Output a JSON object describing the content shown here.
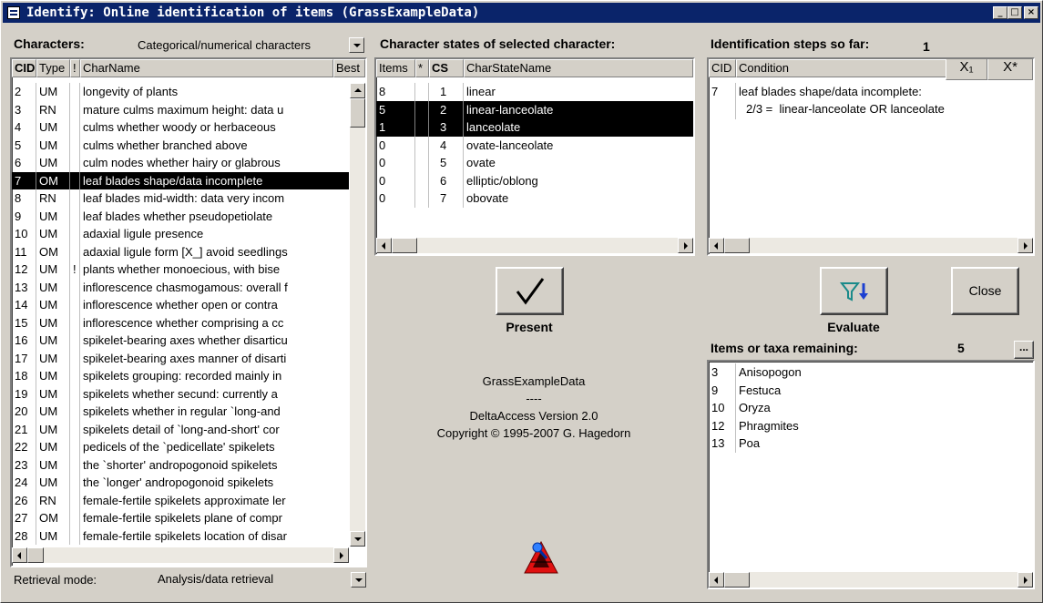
{
  "window": {
    "title": "Identify: Online identification of items (GrassExampleData)",
    "icon": "form-icon",
    "minimize": "_",
    "maximize": "□",
    "close": "×"
  },
  "characters": {
    "label": "Characters:",
    "filter_value": "Categorical/numerical characters",
    "headers": {
      "cid": "CID",
      "type": "Type",
      "excl": "!",
      "name": "CharName",
      "best": "Best"
    },
    "rows": [
      {
        "cid": "2",
        "type": "UM",
        "excl": "",
        "name": "longevity of plants"
      },
      {
        "cid": "3",
        "type": "RN",
        "excl": "",
        "name": "mature culms maximum height: data u"
      },
      {
        "cid": "4",
        "type": "UM",
        "excl": "",
        "name": "culms whether woody or herbaceous"
      },
      {
        "cid": "5",
        "type": "UM",
        "excl": "",
        "name": "culms whether branched above"
      },
      {
        "cid": "6",
        "type": "UM",
        "excl": "",
        "name": "culm nodes whether hairy or glabrous"
      },
      {
        "cid": "7",
        "type": "OM",
        "excl": "",
        "name": "leaf blades shape/data incomplete",
        "selected": true
      },
      {
        "cid": "8",
        "type": "RN",
        "excl": "",
        "name": "leaf blades mid-width: data very incom"
      },
      {
        "cid": "9",
        "type": "UM",
        "excl": "",
        "name": "leaf blades whether pseudopetiolate"
      },
      {
        "cid": "10",
        "type": "UM",
        "excl": "",
        "name": "adaxial ligule presence"
      },
      {
        "cid": "11",
        "type": "OM",
        "excl": "",
        "name": "adaxial ligule form [X_] avoid seedlings"
      },
      {
        "cid": "12",
        "type": "UM",
        "excl": "!",
        "name": "plants whether monoecious, with bise"
      },
      {
        "cid": "13",
        "type": "UM",
        "excl": "",
        "name": "inflorescence chasmogamous: overall f"
      },
      {
        "cid": "14",
        "type": "UM",
        "excl": "",
        "name": "inflorescence whether open or contra"
      },
      {
        "cid": "15",
        "type": "UM",
        "excl": "",
        "name": "inflorescence whether comprising a cc"
      },
      {
        "cid": "16",
        "type": "UM",
        "excl": "",
        "name": "spikelet-bearing axes whether disarticu"
      },
      {
        "cid": "17",
        "type": "UM",
        "excl": "",
        "name": "spikelet-bearing axes manner of disarti"
      },
      {
        "cid": "18",
        "type": "UM",
        "excl": "",
        "name": "spikelets grouping: recorded mainly in"
      },
      {
        "cid": "19",
        "type": "UM",
        "excl": "",
        "name": "spikelets whether secund: currently a"
      },
      {
        "cid": "20",
        "type": "UM",
        "excl": "",
        "name": "spikelets whether in regular `long-and"
      },
      {
        "cid": "21",
        "type": "UM",
        "excl": "",
        "name": "spikelets detail of `long-and-short' cor"
      },
      {
        "cid": "22",
        "type": "UM",
        "excl": "",
        "name": "pedicels of the `pedicellate' spikelets"
      },
      {
        "cid": "23",
        "type": "UM",
        "excl": "",
        "name": "the `shorter' andropogonoid spikelets"
      },
      {
        "cid": "24",
        "type": "UM",
        "excl": "",
        "name": "the `longer' andropogonoid spikelets"
      },
      {
        "cid": "26",
        "type": "RN",
        "excl": "",
        "name": "female-fertile spikelets approximate ler"
      },
      {
        "cid": "27",
        "type": "OM",
        "excl": "",
        "name": "female-fertile spikelets plane of compr"
      },
      {
        "cid": "28",
        "type": "UM",
        "excl": "",
        "name": "female-fertile spikelets location of disar"
      }
    ],
    "retrieval_label": "Retrieval mode:",
    "retrieval_value": "Analysis/data retrieval"
  },
  "states": {
    "label": "Character states of selected character:",
    "headers": {
      "items": "Items",
      "star": "*",
      "cs": "CS",
      "name": "CharStateName"
    },
    "rows": [
      {
        "items": "8",
        "star": "",
        "cs": "1",
        "name": "linear"
      },
      {
        "items": "5",
        "star": "",
        "cs": "2",
        "name": "linear-lanceolate",
        "selected": true
      },
      {
        "items": "1",
        "star": "",
        "cs": "3",
        "name": "lanceolate",
        "selected": true
      },
      {
        "items": "0",
        "star": "",
        "cs": "4",
        "name": "ovate-lanceolate"
      },
      {
        "items": "0",
        "star": "",
        "cs": "5",
        "name": "ovate"
      },
      {
        "items": "0",
        "star": "",
        "cs": "6",
        "name": "elliptic/oblong"
      },
      {
        "items": "0",
        "star": "",
        "cs": "7",
        "name": "obovate"
      }
    ]
  },
  "present": {
    "label": "Present",
    "icon": "checkmark-icon"
  },
  "about": {
    "dataset": "GrassExampleData",
    "separator": "----",
    "version": "DeltaAccess Version 2.0",
    "copyright": "Copyright © 1995-2007 G. Hagedorn",
    "logo": "delta-logo-icon"
  },
  "steps": {
    "label": "Identification steps so far:",
    "count": "1",
    "headers": {
      "cid": "CID",
      "condition": "Condition",
      "remove_one": "X₁",
      "remove_all": "X*"
    },
    "rows": [
      {
        "cid": "7",
        "line1": "leaf blades shape/data incomplete:",
        "line2": "2/3 =  linear-lanceolate OR lanceolate"
      }
    ]
  },
  "evaluate": {
    "label": "Evaluate",
    "icon": "funnel-sort-icon"
  },
  "close_label": "Close",
  "remaining": {
    "label": "Items or taxa remaining:",
    "count": "5",
    "more": "...",
    "rows": [
      {
        "id": "3",
        "name": "Anisopogon"
      },
      {
        "id": "9",
        "name": "Festuca"
      },
      {
        "id": "10",
        "name": "Oryza"
      },
      {
        "id": "12",
        "name": "Phragmites"
      },
      {
        "id": "13",
        "name": "Poa"
      }
    ]
  },
  "colors": {
    "titlebar": "#0a246a",
    "face": "#d4d0c8",
    "selection": "#000000",
    "funnel": "#1a8a8a",
    "arrow": "#1c3fd1"
  }
}
